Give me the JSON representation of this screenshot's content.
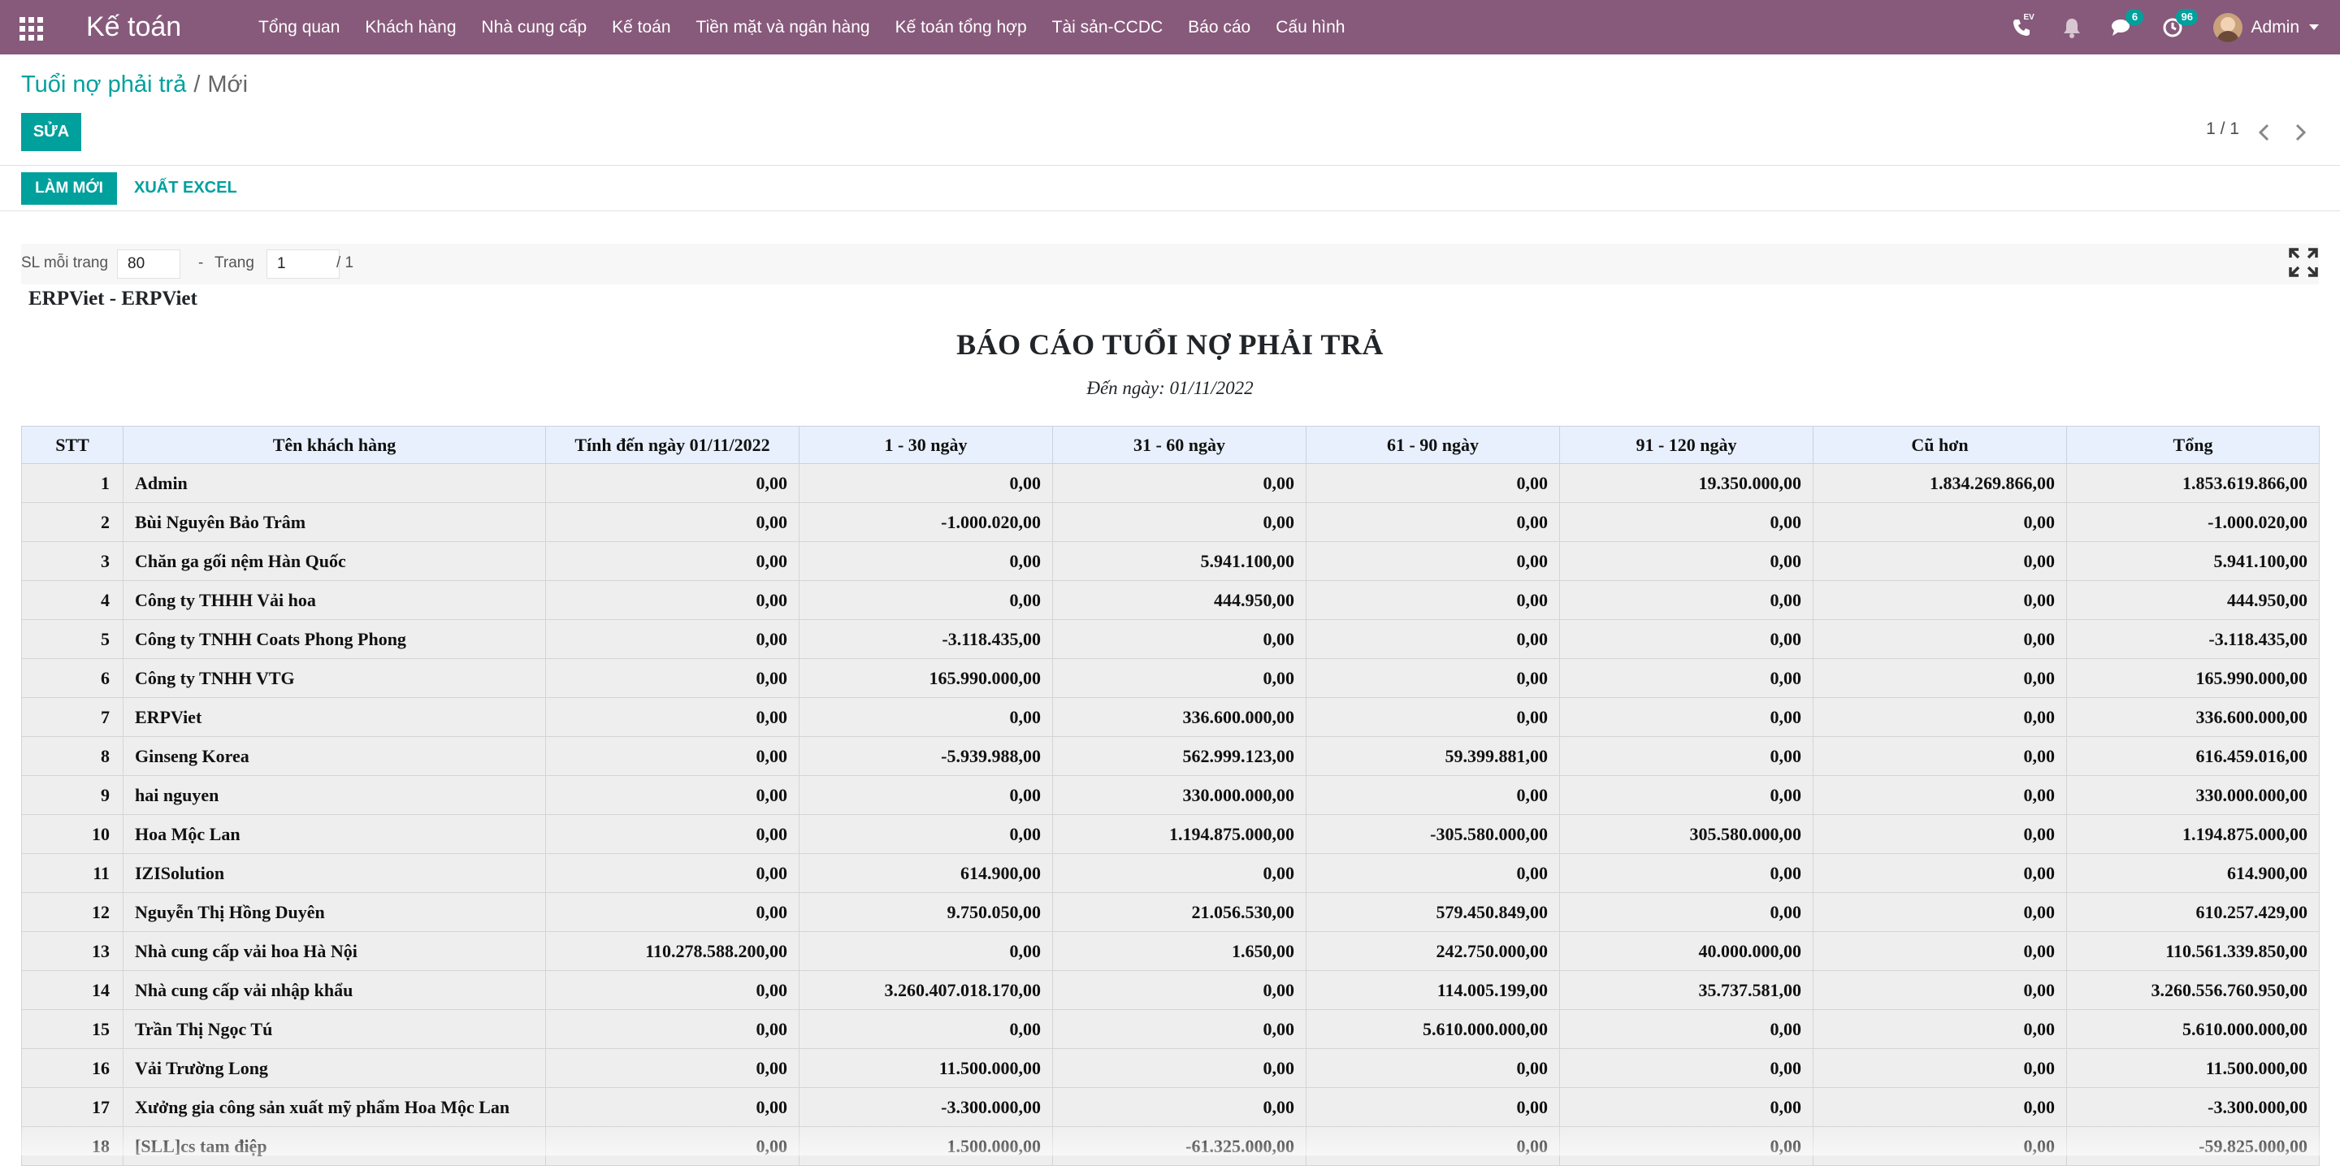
{
  "navbar": {
    "brand": "Kế toán",
    "menu": [
      "Tổng quan",
      "Khách hàng",
      "Nhà cung cấp",
      "Kế toán",
      "Tiền mặt và ngân hàng",
      "Kế toán tổng hợp",
      "Tài sản-CCDC",
      "Báo cáo",
      "Cấu hình"
    ],
    "messages_count": "6",
    "activities_count": "96",
    "user": "Admin",
    "phone_label": "EV"
  },
  "breadcrumb": {
    "parent": "Tuổi nợ phải trả",
    "separator": "/",
    "current": "Mới"
  },
  "buttons": {
    "edit": "SỬA",
    "refresh": "LÀM MỚI",
    "export": "XUẤT EXCEL"
  },
  "pager": {
    "value": "1 / 1"
  },
  "report_pager": {
    "per_page_label": "SL mỗi trang",
    "per_page": "80",
    "dash": "-",
    "page_label": "Trang",
    "page": "1",
    "total": "/ 1"
  },
  "report": {
    "company": "ERPViet - ERPViet",
    "title": "BÁO CÁO TUỔI NỢ PHẢI TRẢ",
    "subtitle": "Đến ngày: 01/11/2022",
    "columns": [
      "STT",
      "Tên khách hàng",
      "Tính đến ngày 01/11/2022",
      "1 - 30 ngày",
      "31 - 60 ngày",
      "61 - 90 ngày",
      "91 - 120 ngày",
      "Cũ hơn",
      "Tổng"
    ],
    "rows": [
      [
        "1",
        "Admin",
        "0,00",
        "0,00",
        "0,00",
        "0,00",
        "19.350.000,00",
        "1.834.269.866,00",
        "1.853.619.866,00"
      ],
      [
        "2",
        "Bùi Nguyên Bảo Trâm",
        "0,00",
        "-1.000.020,00",
        "0,00",
        "0,00",
        "0,00",
        "0,00",
        "-1.000.020,00"
      ],
      [
        "3",
        "Chăn ga gối nệm Hàn Quốc",
        "0,00",
        "0,00",
        "5.941.100,00",
        "0,00",
        "0,00",
        "0,00",
        "5.941.100,00"
      ],
      [
        "4",
        "Công ty THHH Vải hoa",
        "0,00",
        "0,00",
        "444.950,00",
        "0,00",
        "0,00",
        "0,00",
        "444.950,00"
      ],
      [
        "5",
        "Công ty TNHH Coats Phong Phong",
        "0,00",
        "-3.118.435,00",
        "0,00",
        "0,00",
        "0,00",
        "0,00",
        "-3.118.435,00"
      ],
      [
        "6",
        "Công ty TNHH VTG",
        "0,00",
        "165.990.000,00",
        "0,00",
        "0,00",
        "0,00",
        "0,00",
        "165.990.000,00"
      ],
      [
        "7",
        "ERPViet",
        "0,00",
        "0,00",
        "336.600.000,00",
        "0,00",
        "0,00",
        "0,00",
        "336.600.000,00"
      ],
      [
        "8",
        "Ginseng Korea",
        "0,00",
        "-5.939.988,00",
        "562.999.123,00",
        "59.399.881,00",
        "0,00",
        "0,00",
        "616.459.016,00"
      ],
      [
        "9",
        "hai nguyen",
        "0,00",
        "0,00",
        "330.000.000,00",
        "0,00",
        "0,00",
        "0,00",
        "330.000.000,00"
      ],
      [
        "10",
        "Hoa Mộc Lan",
        "0,00",
        "0,00",
        "1.194.875.000,00",
        "-305.580.000,00",
        "305.580.000,00",
        "0,00",
        "1.194.875.000,00"
      ],
      [
        "11",
        "IZISolution",
        "0,00",
        "614.900,00",
        "0,00",
        "0,00",
        "0,00",
        "0,00",
        "614.900,00"
      ],
      [
        "12",
        "Nguyễn Thị Hồng Duyên",
        "0,00",
        "9.750.050,00",
        "21.056.530,00",
        "579.450.849,00",
        "0,00",
        "0,00",
        "610.257.429,00"
      ],
      [
        "13",
        "Nhà cung cấp vải hoa Hà Nội",
        "110.278.588.200,00",
        "0,00",
        "1.650,00",
        "242.750.000,00",
        "40.000.000,00",
        "0,00",
        "110.561.339.850,00"
      ],
      [
        "14",
        "Nhà cung cấp vải nhập khẩu",
        "0,00",
        "3.260.407.018.170,00",
        "0,00",
        "114.005.199,00",
        "35.737.581,00",
        "0,00",
        "3.260.556.760.950,00"
      ],
      [
        "15",
        "Trần Thị Ngọc Tú",
        "0,00",
        "0,00",
        "0,00",
        "5.610.000.000,00",
        "0,00",
        "0,00",
        "5.610.000.000,00"
      ],
      [
        "16",
        "Vải Trường Long",
        "0,00",
        "11.500.000,00",
        "0,00",
        "0,00",
        "0,00",
        "0,00",
        "11.500.000,00"
      ],
      [
        "17",
        "Xưởng gia công sản xuất mỹ phẩm Hoa Mộc Lan",
        "0,00",
        "-3.300.000,00",
        "0,00",
        "0,00",
        "0,00",
        "0,00",
        "-3.300.000,00"
      ],
      [
        "18",
        "[SLL]cs tam điệp",
        "0,00",
        "1.500.000,00",
        "-61.325.000,00",
        "0,00",
        "0,00",
        "0,00",
        "-59.825.000,00"
      ]
    ]
  },
  "colors": {
    "navbar": "#875a7b",
    "primary": "#00a09d",
    "header_bg": "#e8f0fd",
    "row_bg": "#eeeeee"
  }
}
